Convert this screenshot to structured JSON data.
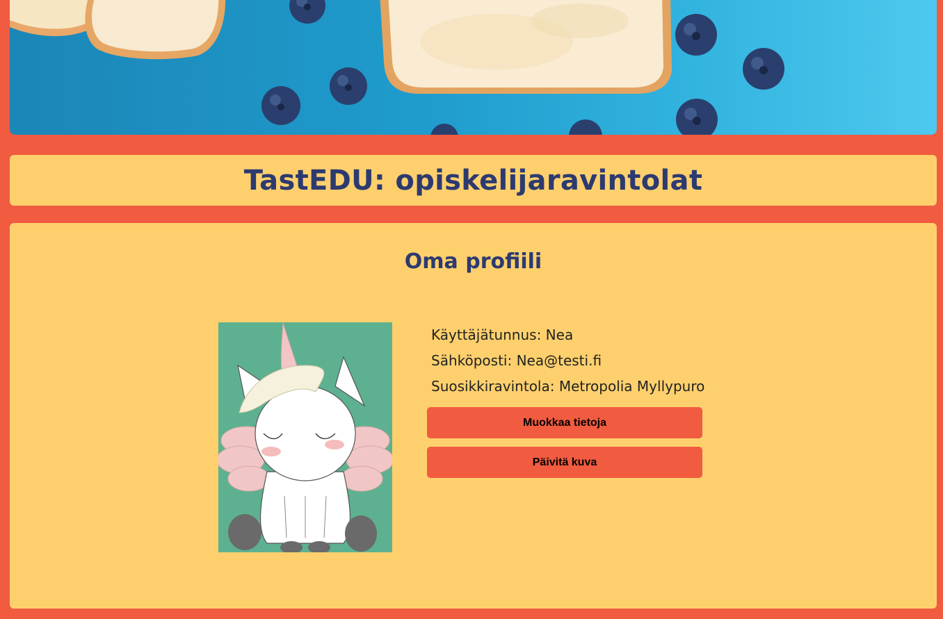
{
  "header": {
    "title": "TastEDU: opiskelijaravintolat"
  },
  "profile": {
    "heading": "Oma profiili",
    "username_label": "Käyttäjätunnus:",
    "username": "Nea",
    "email_label": "Sähköposti:",
    "email": "Nea@testi.fi",
    "favorite_label": "Suosikkiravintola:",
    "favorite": "Metropolia Myllypuro",
    "edit_button": "Muokkaa tietoja",
    "update_image_button": "Päivitä kuva"
  },
  "colors": {
    "page_background": "#f15b40",
    "panel_background": "#fed06d",
    "heading_text": "#2c3a70",
    "button_background": "#f15b40",
    "avatar_background": "#5db190"
  }
}
